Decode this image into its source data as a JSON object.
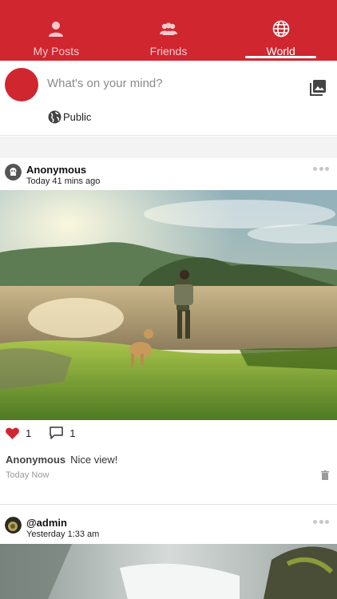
{
  "tabs": [
    {
      "label": "My Posts",
      "icon": "person-icon"
    },
    {
      "label": "Friends",
      "icon": "group-icon"
    },
    {
      "label": "World",
      "icon": "globe-icon"
    }
  ],
  "active_tab": "World",
  "composer": {
    "placeholder": "What's on your mind?",
    "privacy": "Public"
  },
  "posts": [
    {
      "author": "Anonymous",
      "time": "Today 41 mins ago",
      "likes": "1",
      "comments": "1",
      "comment": {
        "author": "Anonymous",
        "text": "Nice view!",
        "time": "Today Now"
      }
    },
    {
      "author": "@admin",
      "time": "Yesterday 1:33 am"
    }
  ],
  "colors": {
    "brand": "#d0262f",
    "like": "#d0262f"
  }
}
